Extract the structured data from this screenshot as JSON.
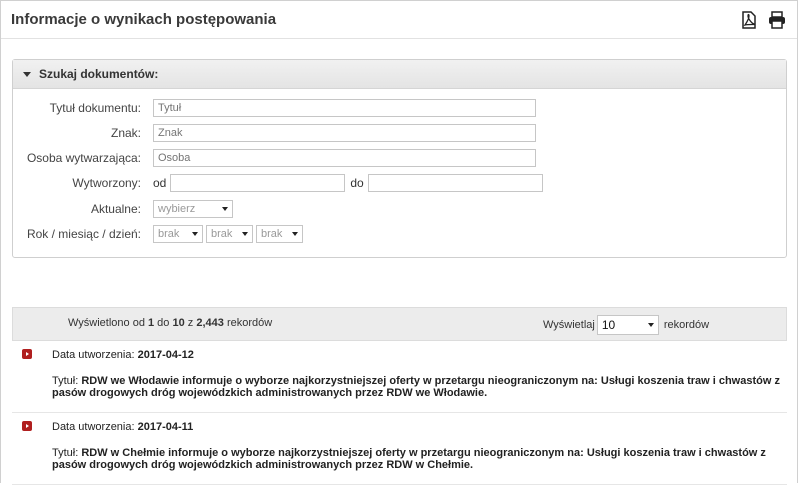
{
  "header": {
    "title": "Informacje o wynikach postępowania",
    "pdf_icon": "pdf-icon",
    "print_icon": "print-icon"
  },
  "search": {
    "title": "Szukaj dokumentów:",
    "fields": {
      "tytul": {
        "label": "Tytuł dokumentu:",
        "placeholder": "Tytuł"
      },
      "znak": {
        "label": "Znak:",
        "placeholder": "Znak"
      },
      "osoba": {
        "label": "Osoba wytwarzająca:",
        "placeholder": "Osoba"
      },
      "wytworzony": {
        "label": "Wytworzony:",
        "from": "od",
        "to": "do"
      },
      "aktualne": {
        "label": "Aktualne:",
        "value": "wybierz"
      },
      "data": {
        "label": "Rok / miesiąc / dzień:",
        "rok": "brak",
        "miesiac": "brak",
        "dzien": "brak"
      }
    }
  },
  "pager": {
    "pre": "Wyświetlono od ",
    "from": "1",
    "mid1": " do ",
    "to": "10",
    "mid2": " z ",
    "total": "2,443",
    "post": " rekordów",
    "show_label": "Wyświetlaj",
    "page_size": "10",
    "records": "rekordów"
  },
  "results": [
    {
      "date_label": "Data utworzenia: ",
      "date": "2017-04-12",
      "title_label": "Tytuł: ",
      "title": "RDW we Włodawie informuje o wyborze najkorzystniejszej oferty w przetargu nieograniczonym na: Usługi koszenia traw i chwastów z pasów drogowych dróg wojewódzkich administrowanych przez RDW we Włodawie."
    },
    {
      "date_label": "Data utworzenia: ",
      "date": "2017-04-11",
      "title_label": "Tytuł: ",
      "title": "RDW w Chełmie informuje o wyborze najkorzystniejszej oferty w przetargu nieograniczonym na: Usługi koszenia traw i chwastów z pasów drogowych dróg wojewódzkich administrowanych przez RDW w Chełmie."
    }
  ]
}
